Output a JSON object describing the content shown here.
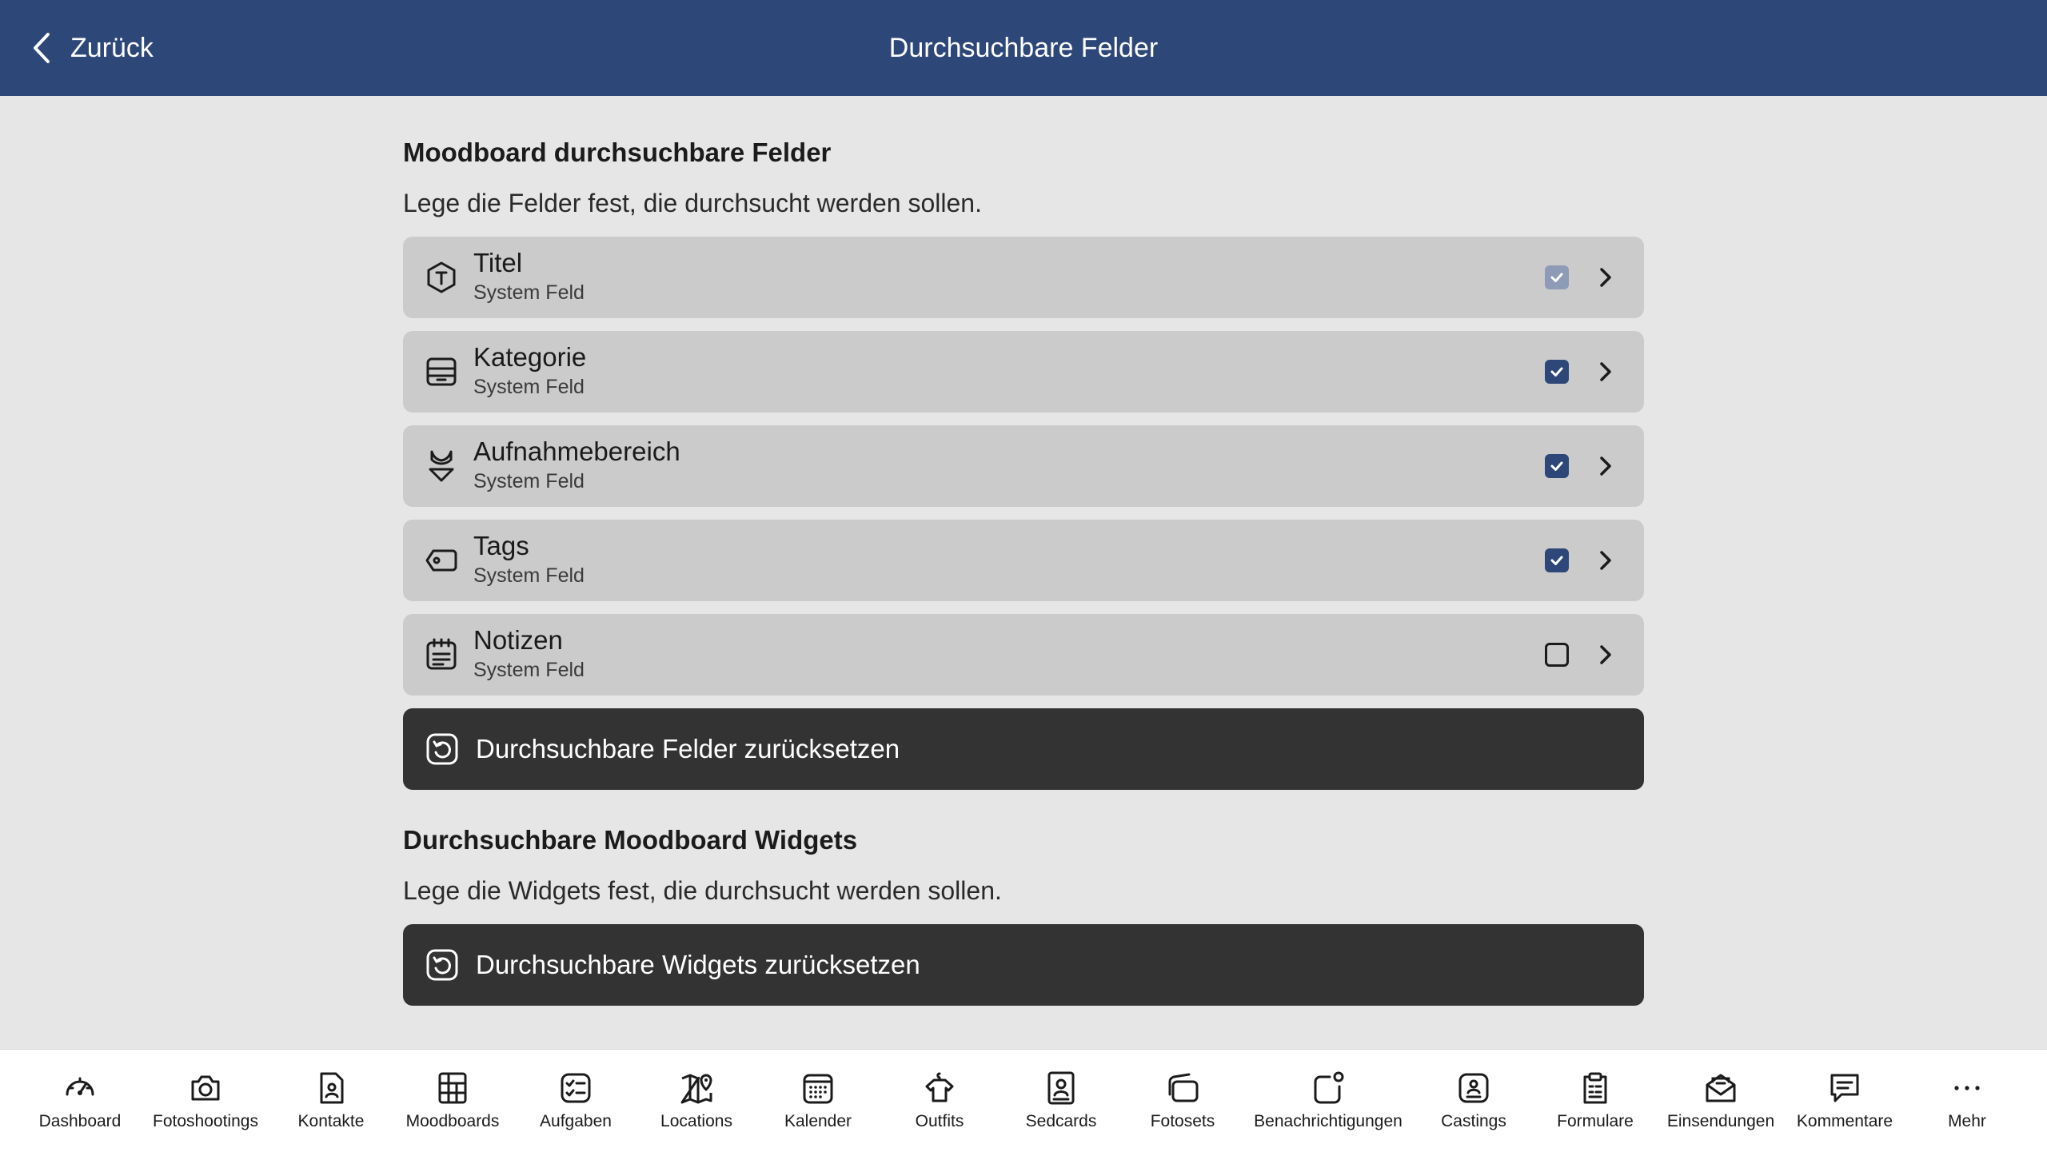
{
  "header": {
    "back_label": "Zurück",
    "title": "Durchsuchbare Felder"
  },
  "fields_section": {
    "title": "Moodboard durchsuchbare Felder",
    "description": "Lege die Felder fest, die durchsucht werden sollen.",
    "items": [
      {
        "label": "Titel",
        "sub": "System Feld",
        "icon": "title-hexagon-icon",
        "state": "checked-disabled"
      },
      {
        "label": "Kategorie",
        "sub": "System Feld",
        "icon": "archive-box-icon",
        "state": "checked"
      },
      {
        "label": "Aufnahmebereich",
        "sub": "System Feld",
        "icon": "bikini-icon",
        "state": "checked"
      },
      {
        "label": "Tags",
        "sub": "System Feld",
        "icon": "tag-icon",
        "state": "checked"
      },
      {
        "label": "Notizen",
        "sub": "System Feld",
        "icon": "notes-icon",
        "state": "unchecked"
      }
    ],
    "reset_label": "Durchsuchbare Felder zurücksetzen"
  },
  "widgets_section": {
    "title": "Durchsuchbare Moodboard Widgets",
    "description": "Lege die Widgets fest, die durchsucht werden sollen.",
    "reset_label": "Durchsuchbare Widgets zurücksetzen"
  },
  "tabbar": {
    "items": [
      {
        "label": "Dashboard",
        "icon": "speedometer-icon"
      },
      {
        "label": "Fotoshootings",
        "icon": "camera-icon"
      },
      {
        "label": "Kontakte",
        "icon": "contact-card-icon"
      },
      {
        "label": "Moodboards",
        "icon": "moodboard-grid-icon"
      },
      {
        "label": "Aufgaben",
        "icon": "task-list-icon"
      },
      {
        "label": "Locations",
        "icon": "map-pin-icon"
      },
      {
        "label": "Kalender",
        "icon": "calendar-icon"
      },
      {
        "label": "Outfits",
        "icon": "shirt-icon"
      },
      {
        "label": "Sedcards",
        "icon": "sedcard-icon"
      },
      {
        "label": "Fotosets",
        "icon": "photo-stack-icon"
      },
      {
        "label": "Benachrichtigungen",
        "icon": "notification-icon"
      },
      {
        "label": "Castings",
        "icon": "casting-icon"
      },
      {
        "label": "Formulare",
        "icon": "clipboard-form-icon"
      },
      {
        "label": "Einsendungen",
        "icon": "envelope-open-icon"
      },
      {
        "label": "Kommentare",
        "icon": "comment-icon"
      },
      {
        "label": "Mehr",
        "icon": "more-dots-icon"
      }
    ]
  },
  "colors": {
    "header_bg": "#2d4779",
    "page_bg": "#e6e6e6",
    "row_bg": "#cbcbcb",
    "button_bg": "#333333",
    "checkbox_on": "#2d4779",
    "checkbox_disabled": "#8e9bb6"
  }
}
